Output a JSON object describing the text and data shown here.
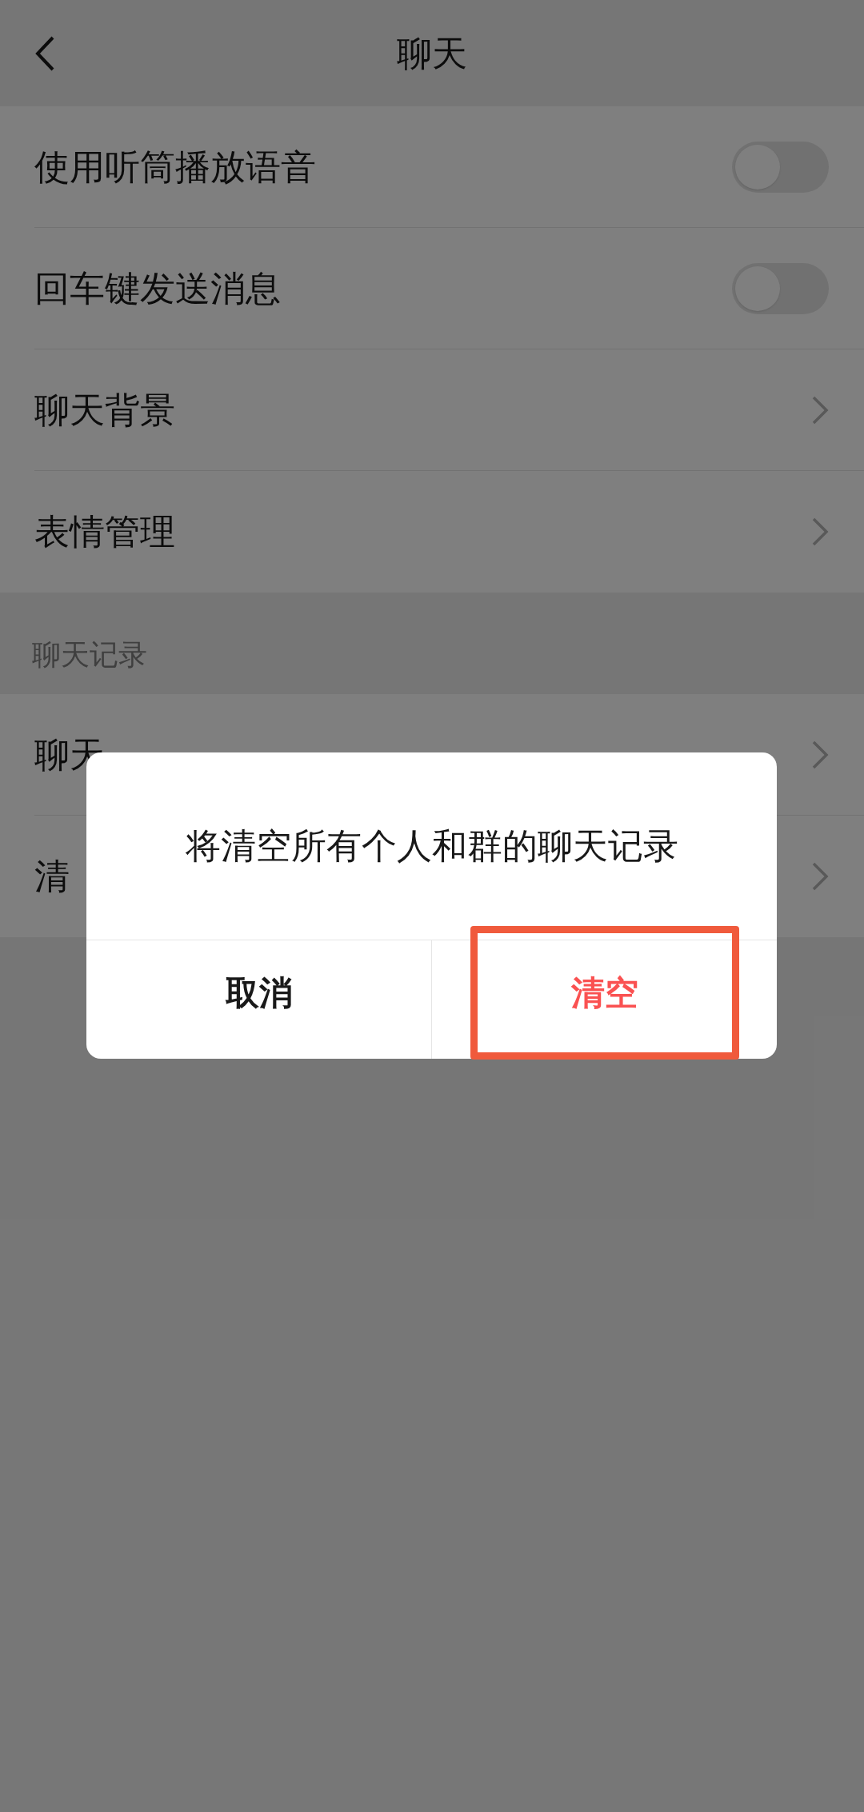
{
  "header": {
    "title": "聊天"
  },
  "settings": [
    {
      "kind": "toggle",
      "label": "使用听筒播放语音",
      "on": false
    },
    {
      "kind": "toggle",
      "label": "回车键发送消息",
      "on": false
    },
    {
      "kind": "link",
      "label": "聊天背景"
    },
    {
      "kind": "link",
      "label": "表情管理"
    }
  ],
  "history_section": {
    "title": "聊天记录",
    "items": [
      {
        "kind": "link",
        "label": "聊天"
      },
      {
        "kind": "link",
        "label": "清"
      }
    ]
  },
  "dialog": {
    "message": "将清空所有个人和群的聊天记录",
    "buttons": [
      {
        "label": "取消",
        "kind": "cancel",
        "highlighted": false
      },
      {
        "label": "清空",
        "kind": "danger",
        "highlighted": true
      }
    ]
  }
}
